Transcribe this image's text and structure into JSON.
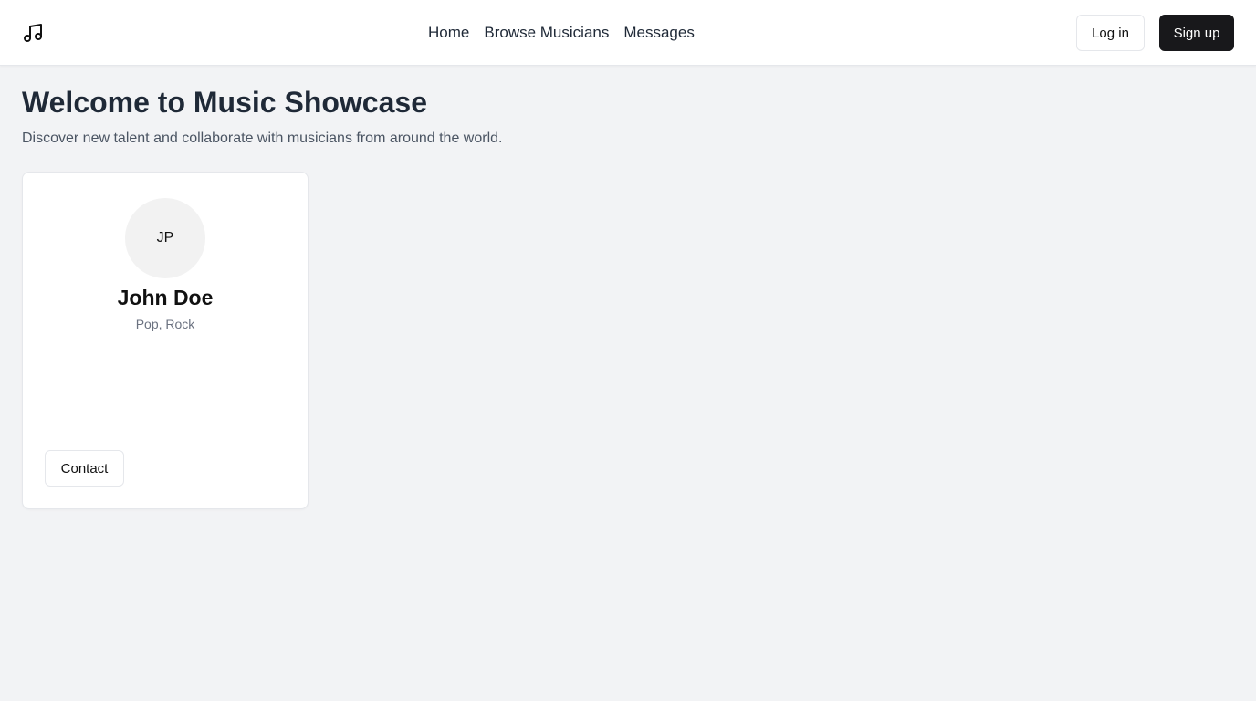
{
  "header": {
    "logo_icon": "music-note-icon",
    "nav": [
      {
        "label": "Home"
      },
      {
        "label": "Browse Musicians"
      },
      {
        "label": "Messages"
      }
    ],
    "login_label": "Log in",
    "signup_label": "Sign up"
  },
  "main": {
    "title": "Welcome to Music Showcase",
    "subtitle": "Discover new talent and collaborate with musicians from around the world."
  },
  "musicians": [
    {
      "initials": "JP",
      "name": "John Doe",
      "genres": "Pop, Rock",
      "contact_label": "Contact"
    }
  ],
  "colors": {
    "background": "#f2f3f5",
    "primary_button": "#18181b",
    "text": "#1f2937"
  }
}
